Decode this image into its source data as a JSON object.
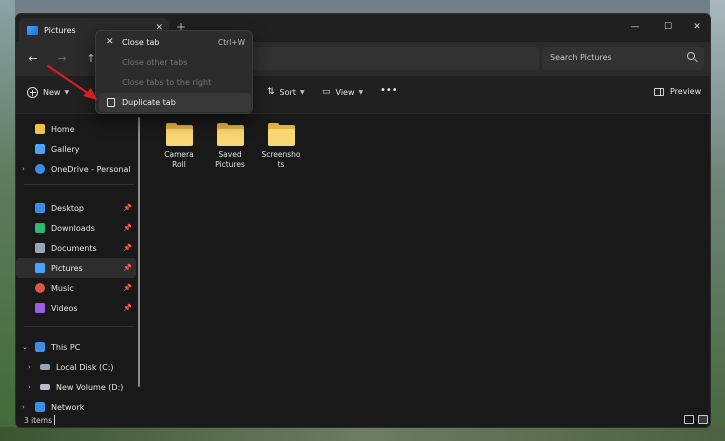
{
  "window": {
    "tab_title": "Pictures",
    "tab_close": "✕",
    "new_tab": "+",
    "controls": {
      "minimize": "—",
      "maximize": "☐",
      "close": "✕"
    }
  },
  "address": {
    "back": "←",
    "forward": "→",
    "up": "↑",
    "search_placeholder": "Search Pictures"
  },
  "commandbar": {
    "new_label": "New",
    "sort_label": "Sort",
    "view_label": "View",
    "more_label": "•••",
    "preview_label": "Preview"
  },
  "context_menu": {
    "items": [
      {
        "label": "Close tab",
        "shortcut": "Ctrl+W",
        "icon": "close-icon",
        "enabled": true
      },
      {
        "label": "Close other tabs",
        "enabled": false
      },
      {
        "label": "Close tabs to the right",
        "enabled": false
      },
      {
        "label": "Duplicate tab",
        "icon": "duplicate-icon",
        "enabled": true,
        "highlighted": true
      }
    ]
  },
  "sidebar": {
    "items": [
      {
        "label": "Home",
        "icon": "home-icon",
        "color": "#f0c24a"
      },
      {
        "label": "Gallery",
        "icon": "gallery-icon",
        "color": "#4aa3ff"
      },
      {
        "label": "OneDrive - Personal",
        "icon": "cloud-icon",
        "color": "#3a8ee6"
      },
      {
        "label": "Desktop",
        "icon": "desktop-icon",
        "color": "#3a8ee6",
        "pinned": true
      },
      {
        "label": "Downloads",
        "icon": "download-icon",
        "color": "#2fb86f",
        "pinned": true
      },
      {
        "label": "Documents",
        "icon": "document-icon",
        "color": "#9aa7b8",
        "pinned": true
      },
      {
        "label": "Pictures",
        "icon": "pictures-icon",
        "color": "#4aa3ff",
        "pinned": true,
        "selected": true
      },
      {
        "label": "Music",
        "icon": "music-icon",
        "color": "#e0584a",
        "pinned": true
      },
      {
        "label": "Videos",
        "icon": "videos-icon",
        "color": "#9b5de5",
        "pinned": true
      },
      {
        "label": "This PC",
        "icon": "pc-icon",
        "color": "#3a8ee6"
      },
      {
        "label": "Local Disk (C:)",
        "icon": "disk-icon",
        "color": "#8fa5bb"
      },
      {
        "label": "New Volume (D:)",
        "icon": "disk-icon",
        "color": "#b5c0cc"
      },
      {
        "label": "Network",
        "icon": "network-icon",
        "color": "#3a8ee6"
      }
    ]
  },
  "folders": [
    {
      "label": "Camera Roll"
    },
    {
      "label": "Saved Pictures"
    },
    {
      "label": "Screenshots"
    }
  ],
  "statusbar": {
    "items_count": "3 items"
  },
  "colors": {
    "accent": "#4aa3ff",
    "folder": "#f8d775",
    "arrow": "#d62020"
  }
}
